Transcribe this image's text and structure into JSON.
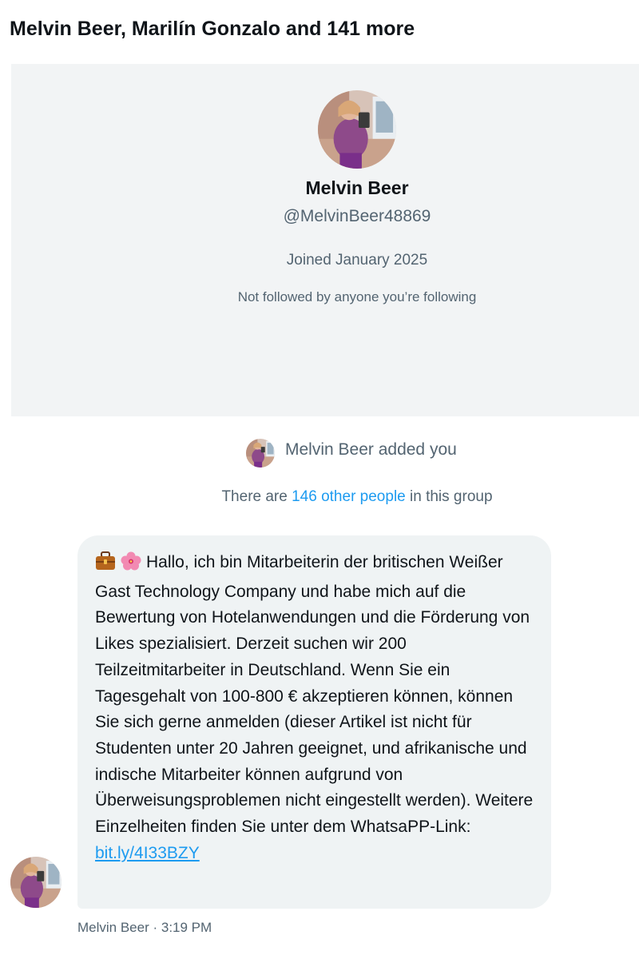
{
  "header": {
    "title": "Melvin Beer, Marilín Gonzalo and 141 more"
  },
  "profile": {
    "avatar_icon": "profile-photo",
    "name": "Melvin Beer",
    "handle": "@MelvinBeer48869",
    "joined": "Joined January 2025",
    "followed_info": "Not followed by anyone you’re following"
  },
  "system_messages": {
    "added_you": "Melvin Beer added you",
    "group_prefix": "There are ",
    "group_link": "146 other people",
    "group_suffix": " in this group"
  },
  "message": {
    "emoji_1": "briefcase-icon",
    "emoji_2": "hibiscus-icon",
    "text": "Hallo, ich bin Mitarbeiterin der britischen Weißer Gast Technology Company und habe mich auf die Bewertung von Hotelanwendungen und die Förderung von Likes spezialisiert. Derzeit suchen wir 200 Teilzeitmitarbeiter in Deutschland. Wenn Sie ein Tagesgehalt von 100-800 € akzeptieren können, können Sie sich gerne anmelden (dieser Artikel ist nicht für Studenten unter 20 Jahren geeignet, und afrikanische und indische Mitarbeiter können aufgrund von Überweisungsproblemen nicht eingestellt werden). Weitere Einzelheiten finden Sie unter dem WhatsaPP-Link:",
    "link": "bit.ly/4I33BZY",
    "sender": "Melvin Beer",
    "separator": " · ",
    "time": "3:19 PM"
  },
  "colors": {
    "accent": "#1d9bf0",
    "card_bg": "#f2f4f5",
    "bubble_bg": "#eff3f4",
    "secondary_text": "#536471"
  }
}
